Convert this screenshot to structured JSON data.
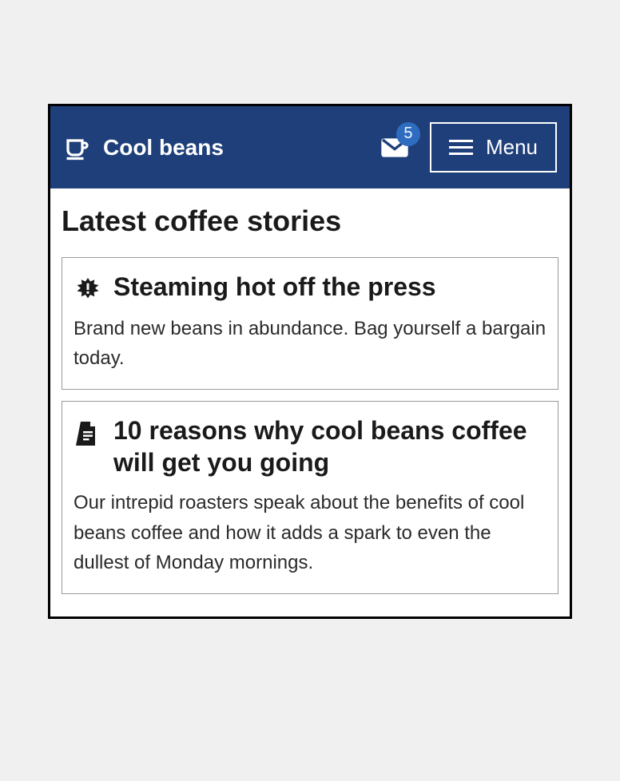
{
  "header": {
    "brand": "Cool beans",
    "mail_count": "5",
    "menu_label": "Menu"
  },
  "main": {
    "title": "Latest coffee stories",
    "stories": [
      {
        "icon": "burst-alert",
        "title": "Steaming hot off the press",
        "body": "Brand new beans in abundance. Bag yourself a bargain today."
      },
      {
        "icon": "document",
        "title": "10 reasons why cool beans coffee will get you going",
        "body": "Our intrepid roasters speak about the benefits of cool beans coffee and how it adds a spark to even the dullest of Monday mornings."
      }
    ]
  }
}
